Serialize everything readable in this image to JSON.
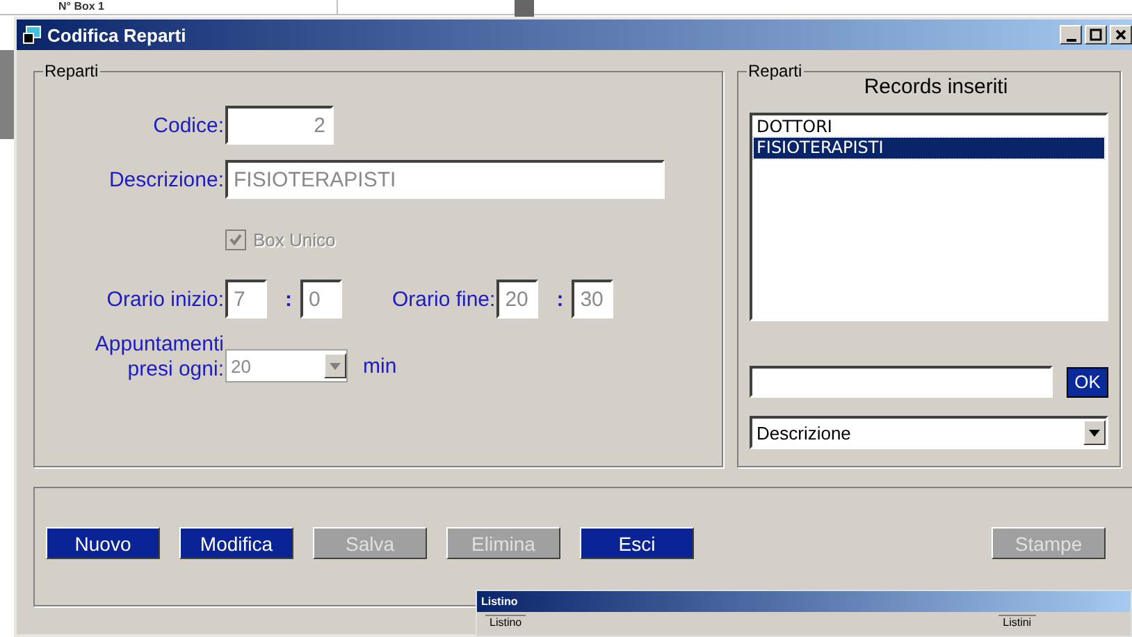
{
  "background_table": {
    "cell": "N° Box 1"
  },
  "window": {
    "title": "Codifica Reparti"
  },
  "reparti_group": {
    "title": "Reparti",
    "codice": {
      "label": "Codice:",
      "value": "2"
    },
    "descrizione": {
      "label": "Descrizione:",
      "value": "FISIOTERAPISTI"
    },
    "box_unico": {
      "label": "Box Unico",
      "checked": true,
      "disabled": true
    },
    "orario_inizio": {
      "label": "Orario inizio:",
      "hours": "7",
      "separator": ":",
      "minutes": "0"
    },
    "orario_fine": {
      "label": "Orario fine:",
      "hours": "20",
      "separator": ":",
      "minutes": "30"
    },
    "appuntamenti": {
      "label": "Appuntamenti presi ogni:",
      "value": "20",
      "unit": "min"
    }
  },
  "records_group": {
    "title": "Reparti",
    "heading": "Records inseriti",
    "items": [
      {
        "label": "DOTTORI",
        "selected": false
      },
      {
        "label": "FISIOTERAPISTI",
        "selected": true
      }
    ],
    "ok_button": "OK",
    "sort_dropdown": "Descrizione"
  },
  "buttons": [
    {
      "label": "Nuovo",
      "disabled": false
    },
    {
      "label": "Modifica",
      "disabled": false
    },
    {
      "label": "Salva",
      "disabled": true
    },
    {
      "label": "Elimina",
      "disabled": true
    },
    {
      "label": "Esci",
      "disabled": false
    },
    {
      "label": "Stampe",
      "disabled": true
    }
  ],
  "listino_window": {
    "title": "Listino",
    "groups": [
      "Listino",
      "Listini"
    ]
  }
}
